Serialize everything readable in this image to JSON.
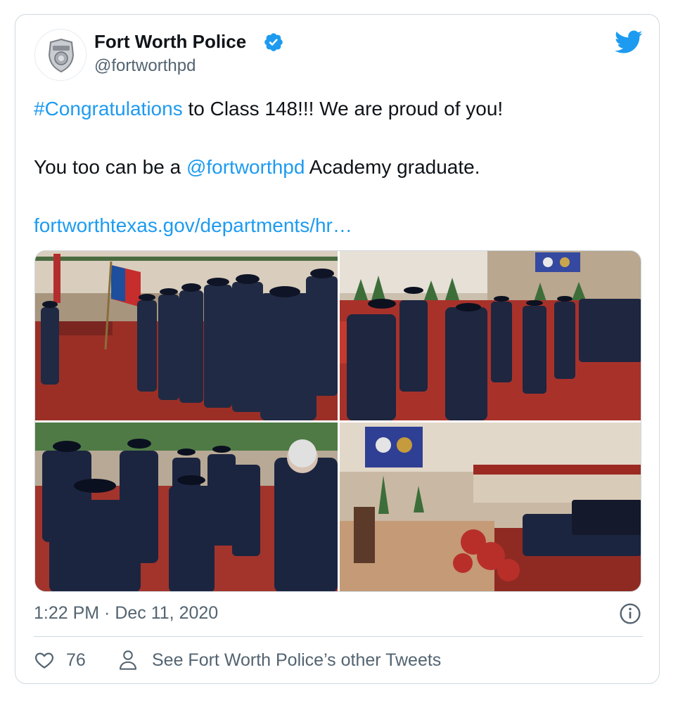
{
  "tweet": {
    "author_name": "Fort Worth Police",
    "author_handle": "@fortworthpd",
    "verified": true,
    "avatar_icon": "police-badge-icon",
    "platform_icon": "twitter-bird-icon",
    "text": {
      "hashtag": "#Congratulations",
      "line1_rest": " to Class 148!!! We are proud of you!",
      "line2_prefix": "You too can be a ",
      "mention": "@fortworthpd",
      "line2_suffix": " Academy graduate.",
      "link": "fortworthtexas.gov/departments/hr…"
    },
    "media": [
      {
        "id": "photo-1"
      },
      {
        "id": "photo-2"
      },
      {
        "id": "photo-3"
      },
      {
        "id": "photo-4"
      }
    ],
    "timestamp": "1:22 PM · Dec 11, 2020",
    "actions": {
      "like_icon": "heart-icon",
      "like_count": "76",
      "profile_icon": "person-icon",
      "other_tweets_label": "See Fort Worth Police’s other Tweets"
    },
    "colors": {
      "link": "#1d9bf0",
      "verified": "#1d9bf0",
      "muted": "#536471",
      "border": "#cfd9de"
    }
  }
}
